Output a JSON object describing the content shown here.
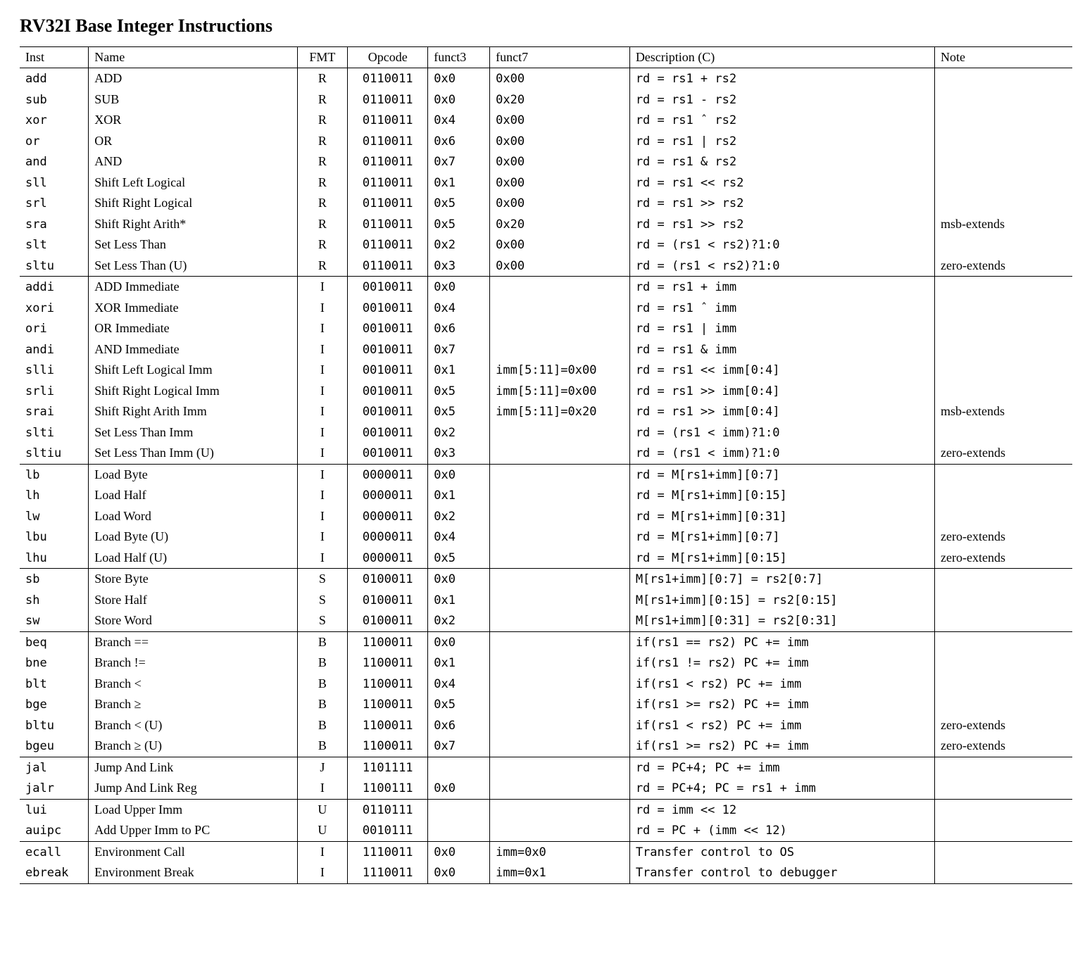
{
  "title": "RV32I Base Integer Instructions",
  "columns": [
    "Inst",
    "Name",
    "FMT",
    "Opcode",
    "funct3",
    "funct7",
    "Description (C)",
    "Note"
  ],
  "groups": [
    {
      "rows": [
        {
          "inst": "add",
          "name": "ADD",
          "fmt": "R",
          "opcode": "0110011",
          "f3": "0x0",
          "f7": "0x00",
          "desc": "rd = rs1 + rs2",
          "note": ""
        },
        {
          "inst": "sub",
          "name": "SUB",
          "fmt": "R",
          "opcode": "0110011",
          "f3": "0x0",
          "f7": "0x20",
          "desc": "rd = rs1 - rs2",
          "note": ""
        },
        {
          "inst": "xor",
          "name": "XOR",
          "fmt": "R",
          "opcode": "0110011",
          "f3": "0x4",
          "f7": "0x00",
          "desc": "rd = rs1 ˆ rs2",
          "note": ""
        },
        {
          "inst": "or",
          "name": "OR",
          "fmt": "R",
          "opcode": "0110011",
          "f3": "0x6",
          "f7": "0x00",
          "desc": "rd = rs1 | rs2",
          "note": ""
        },
        {
          "inst": "and",
          "name": "AND",
          "fmt": "R",
          "opcode": "0110011",
          "f3": "0x7",
          "f7": "0x00",
          "desc": "rd = rs1 & rs2",
          "note": ""
        },
        {
          "inst": "sll",
          "name": "Shift Left Logical",
          "fmt": "R",
          "opcode": "0110011",
          "f3": "0x1",
          "f7": "0x00",
          "desc": "rd = rs1 << rs2",
          "note": ""
        },
        {
          "inst": "srl",
          "name": "Shift Right Logical",
          "fmt": "R",
          "opcode": "0110011",
          "f3": "0x5",
          "f7": "0x00",
          "desc": "rd = rs1 >> rs2",
          "note": ""
        },
        {
          "inst": "sra",
          "name": "Shift Right Arith*",
          "fmt": "R",
          "opcode": "0110011",
          "f3": "0x5",
          "f7": "0x20",
          "desc": "rd = rs1 >> rs2",
          "note": "msb-extends"
        },
        {
          "inst": "slt",
          "name": "Set Less Than",
          "fmt": "R",
          "opcode": "0110011",
          "f3": "0x2",
          "f7": "0x00",
          "desc": "rd = (rs1 < rs2)?1:0",
          "note": ""
        },
        {
          "inst": "sltu",
          "name": "Set Less Than (U)",
          "fmt": "R",
          "opcode": "0110011",
          "f3": "0x3",
          "f7": "0x00",
          "desc": "rd = (rs1 < rs2)?1:0",
          "note": "zero-extends"
        }
      ]
    },
    {
      "rows": [
        {
          "inst": "addi",
          "name": "ADD Immediate",
          "fmt": "I",
          "opcode": "0010011",
          "f3": "0x0",
          "f7": "",
          "desc": "rd = rs1 + imm",
          "note": ""
        },
        {
          "inst": "xori",
          "name": "XOR Immediate",
          "fmt": "I",
          "opcode": "0010011",
          "f3": "0x4",
          "f7": "",
          "desc": "rd = rs1 ˆ imm",
          "note": ""
        },
        {
          "inst": "ori",
          "name": "OR Immediate",
          "fmt": "I",
          "opcode": "0010011",
          "f3": "0x6",
          "f7": "",
          "desc": "rd = rs1 | imm",
          "note": ""
        },
        {
          "inst": "andi",
          "name": "AND Immediate",
          "fmt": "I",
          "opcode": "0010011",
          "f3": "0x7",
          "f7": "",
          "desc": "rd = rs1 & imm",
          "note": ""
        },
        {
          "inst": "slli",
          "name": "Shift Left Logical Imm",
          "fmt": "I",
          "opcode": "0010011",
          "f3": "0x1",
          "f7": "imm[5:11]=0x00",
          "desc": "rd = rs1 << imm[0:4]",
          "note": ""
        },
        {
          "inst": "srli",
          "name": "Shift Right Logical Imm",
          "fmt": "I",
          "opcode": "0010011",
          "f3": "0x5",
          "f7": "imm[5:11]=0x00",
          "desc": "rd = rs1 >> imm[0:4]",
          "note": ""
        },
        {
          "inst": "srai",
          "name": "Shift Right Arith Imm",
          "fmt": "I",
          "opcode": "0010011",
          "f3": "0x5",
          "f7": "imm[5:11]=0x20",
          "desc": "rd = rs1 >> imm[0:4]",
          "note": "msb-extends"
        },
        {
          "inst": "slti",
          "name": "Set Less Than Imm",
          "fmt": "I",
          "opcode": "0010011",
          "f3": "0x2",
          "f7": "",
          "desc": "rd = (rs1 < imm)?1:0",
          "note": ""
        },
        {
          "inst": "sltiu",
          "name": "Set Less Than Imm (U)",
          "fmt": "I",
          "opcode": "0010011",
          "f3": "0x3",
          "f7": "",
          "desc": "rd = (rs1 < imm)?1:0",
          "note": "zero-extends"
        }
      ]
    },
    {
      "rows": [
        {
          "inst": "lb",
          "name": "Load Byte",
          "fmt": "I",
          "opcode": "0000011",
          "f3": "0x0",
          "f7": "",
          "desc": "rd = M[rs1+imm][0:7]",
          "note": ""
        },
        {
          "inst": "lh",
          "name": "Load Half",
          "fmt": "I",
          "opcode": "0000011",
          "f3": "0x1",
          "f7": "",
          "desc": "rd = M[rs1+imm][0:15]",
          "note": ""
        },
        {
          "inst": "lw",
          "name": "Load Word",
          "fmt": "I",
          "opcode": "0000011",
          "f3": "0x2",
          "f7": "",
          "desc": "rd = M[rs1+imm][0:31]",
          "note": ""
        },
        {
          "inst": "lbu",
          "name": "Load Byte (U)",
          "fmt": "I",
          "opcode": "0000011",
          "f3": "0x4",
          "f7": "",
          "desc": "rd = M[rs1+imm][0:7]",
          "note": "zero-extends"
        },
        {
          "inst": "lhu",
          "name": "Load Half (U)",
          "fmt": "I",
          "opcode": "0000011",
          "f3": "0x5",
          "f7": "",
          "desc": "rd = M[rs1+imm][0:15]",
          "note": "zero-extends"
        }
      ]
    },
    {
      "rows": [
        {
          "inst": "sb",
          "name": "Store Byte",
          "fmt": "S",
          "opcode": "0100011",
          "f3": "0x0",
          "f7": "",
          "desc": "M[rs1+imm][0:7] = rs2[0:7]",
          "note": ""
        },
        {
          "inst": "sh",
          "name": "Store Half",
          "fmt": "S",
          "opcode": "0100011",
          "f3": "0x1",
          "f7": "",
          "desc": "M[rs1+imm][0:15] = rs2[0:15]",
          "note": ""
        },
        {
          "inst": "sw",
          "name": "Store Word",
          "fmt": "S",
          "opcode": "0100011",
          "f3": "0x2",
          "f7": "",
          "desc": "M[rs1+imm][0:31] = rs2[0:31]",
          "note": ""
        }
      ]
    },
    {
      "rows": [
        {
          "inst": "beq",
          "name": "Branch ==",
          "fmt": "B",
          "opcode": "1100011",
          "f3": "0x0",
          "f7": "",
          "desc": "if(rs1 == rs2) PC += imm",
          "note": ""
        },
        {
          "inst": "bne",
          "name": "Branch !=",
          "fmt": "B",
          "opcode": "1100011",
          "f3": "0x1",
          "f7": "",
          "desc": "if(rs1 != rs2) PC += imm",
          "note": ""
        },
        {
          "inst": "blt",
          "name": "Branch <",
          "fmt": "B",
          "opcode": "1100011",
          "f3": "0x4",
          "f7": "",
          "desc": "if(rs1 <  rs2) PC += imm",
          "note": ""
        },
        {
          "inst": "bge",
          "name": "Branch ≥",
          "fmt": "B",
          "opcode": "1100011",
          "f3": "0x5",
          "f7": "",
          "desc": "if(rs1 >= rs2) PC += imm",
          "note": ""
        },
        {
          "inst": "bltu",
          "name": "Branch < (U)",
          "fmt": "B",
          "opcode": "1100011",
          "f3": "0x6",
          "f7": "",
          "desc": "if(rs1 <  rs2) PC += imm",
          "note": "zero-extends"
        },
        {
          "inst": "bgeu",
          "name": "Branch ≥ (U)",
          "fmt": "B",
          "opcode": "1100011",
          "f3": "0x7",
          "f7": "",
          "desc": "if(rs1 >= rs2) PC += imm",
          "note": "zero-extends"
        }
      ]
    },
    {
      "rows": [
        {
          "inst": "jal",
          "name": "Jump And Link",
          "fmt": "J",
          "opcode": "1101111",
          "f3": "",
          "f7": "",
          "desc": "rd = PC+4; PC += imm",
          "note": ""
        },
        {
          "inst": "jalr",
          "name": "Jump And Link Reg",
          "fmt": "I",
          "opcode": "1100111",
          "f3": "0x0",
          "f7": "",
          "desc": "rd = PC+4; PC = rs1 + imm",
          "note": ""
        }
      ]
    },
    {
      "rows": [
        {
          "inst": "lui",
          "name": "Load Upper Imm",
          "fmt": "U",
          "opcode": "0110111",
          "f3": "",
          "f7": "",
          "desc": "rd = imm << 12",
          "note": ""
        },
        {
          "inst": "auipc",
          "name": "Add Upper Imm to PC",
          "fmt": "U",
          "opcode": "0010111",
          "f3": "",
          "f7": "",
          "desc": "rd = PC + (imm << 12)",
          "note": ""
        }
      ]
    },
    {
      "rows": [
        {
          "inst": "ecall",
          "name": "Environment Call",
          "fmt": "I",
          "opcode": "1110011",
          "f3": "0x0",
          "f7": "imm=0x0",
          "desc": "Transfer control to OS",
          "note": ""
        },
        {
          "inst": "ebreak",
          "name": "Environment Break",
          "fmt": "I",
          "opcode": "1110011",
          "f3": "0x0",
          "f7": "imm=0x1",
          "desc": "Transfer control to debugger",
          "note": ""
        }
      ]
    }
  ]
}
